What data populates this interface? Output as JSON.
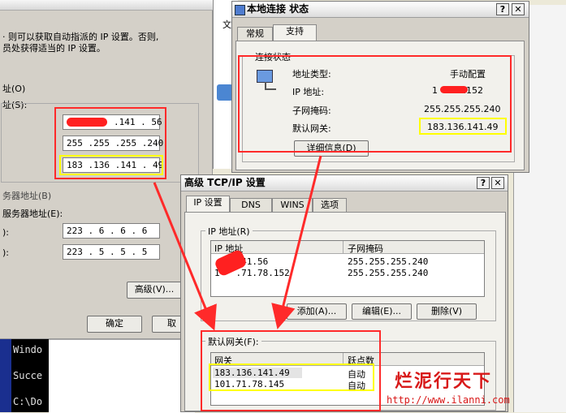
{
  "left_window": {
    "text_line1": "· 则可以获取自动指派的 IP 设置。否则,",
    "text_line2": "员处获得适当的 IP 设置。",
    "label_auto": "址(O)",
    "label_use": "址(S):",
    "ip_value": ".141 . 56",
    "mask_value": "255 .255 .255 .240",
    "gateway_value": "183 .136 .141 . 49",
    "dns_group_label": "务器地址(B)",
    "dns_use_label": "服务器地址(E):",
    "dns1_label": "):",
    "dns2_label": "):",
    "dns1_value": "223 . 6 . 6 . 6",
    "dns2_value": "223 . 5 . 5 . 5",
    "advanced_button": "高级(V)...",
    "ok_button": "确定",
    "cancel_button": "取"
  },
  "top_left_strip": {
    "item": "文"
  },
  "console": {
    "lines": [
      "Windo",
      "Succe",
      "C:\\Do"
    ]
  },
  "status_window": {
    "title": "本地连接 状态",
    "tabs": [
      "常规",
      "支持"
    ],
    "group_label": "连接状态",
    "rows": [
      {
        "label": "地址类型:",
        "value": "手动配置"
      },
      {
        "label": "IP 地址:",
        "value": "1    .78.152"
      },
      {
        "label": "子网掩码:",
        "value": "255.255.255.240"
      },
      {
        "label": "默认网关:",
        "value": "183.136.141.49"
      }
    ],
    "details_button": "详细信息(D)"
  },
  "tcp_window": {
    "title": "高级 TCP/IP 设置",
    "tabs": [
      "IP 设置",
      "DNS",
      "WINS",
      "选项"
    ],
    "ip_group_label": "IP 地址(R)",
    "ip_headers": [
      "IP 地址",
      "子网掩码"
    ],
    "ip_rows": [
      {
        "ip": "   .141.56",
        "mask": "255.255.255.240"
      },
      {
        "ip": "1   .71.78.152",
        "mask": "255.255.255.240"
      }
    ],
    "add_button": "添加(A)...",
    "edit_button": "编辑(E)...",
    "delete_button": "删除(V)",
    "gw_group_label": "默认网关(F):",
    "gw_headers": [
      "网关",
      "跃点数"
    ],
    "gw_rows": [
      {
        "gateway": "183.136.141.49",
        "metric": "自动"
      },
      {
        "gateway": "101.71.78.145",
        "metric": "自动"
      }
    ]
  },
  "watermark": {
    "brand": "烂泥行天下",
    "url": "http://www.ilanni.com"
  },
  "colors": {
    "annotation_red": "#ff2a2a",
    "highlight_yellow": "#ffff00",
    "watermark_red": "#d81818"
  }
}
